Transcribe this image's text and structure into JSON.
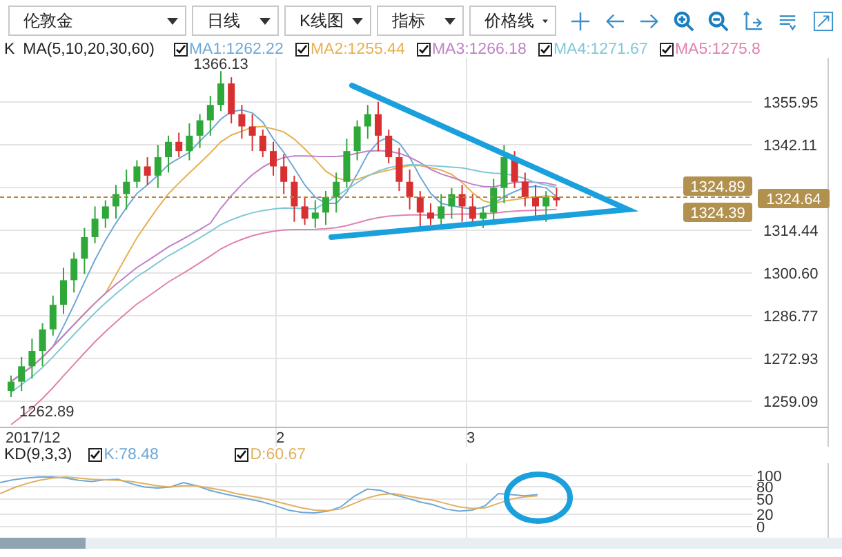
{
  "toolbar": {
    "selects": [
      {
        "value": "伦敦金"
      },
      {
        "value": "日线"
      },
      {
        "value": "K线图"
      },
      {
        "value": "指标"
      },
      {
        "value": "价格线"
      }
    ]
  },
  "legend": {
    "type_label": "K",
    "indicator": "MA(5,10,20,30,60)",
    "items": [
      {
        "label": "MA1:1262.22",
        "checked": true,
        "color": "#6fa8d6"
      },
      {
        "label": "MA2:1255.44",
        "checked": true,
        "color": "#e8b050"
      },
      {
        "label": "MA3:1266.18",
        "checked": true,
        "color": "#c080c8"
      },
      {
        "label": "MA4:1271.67",
        "checked": true,
        "color": "#80c8d8"
      },
      {
        "label": "MA5:1275.8",
        "checked": true,
        "color": "#e080b0"
      }
    ]
  },
  "price_chart": {
    "high_label": "1366.13",
    "low_label": "1262.89",
    "price_axis": [
      "1355.95",
      "1342.11",
      "1314.44",
      "1300.60",
      "1286.77",
      "1272.93",
      "1259.09"
    ],
    "price_tags": [
      "1324.89",
      "1324.39"
    ],
    "current_price": "1324.64",
    "date_axis": [
      "2017/12",
      "2",
      "3"
    ]
  },
  "kd": {
    "indicator": "KD(9,3,3)",
    "items": [
      {
        "label": "K:78.48",
        "checked": true,
        "color": "#6fa8d6"
      },
      {
        "label": "D:60.67",
        "checked": true,
        "color": "#e0b060"
      }
    ],
    "axis": [
      "100",
      "80",
      "50",
      "20",
      "0"
    ]
  }
}
